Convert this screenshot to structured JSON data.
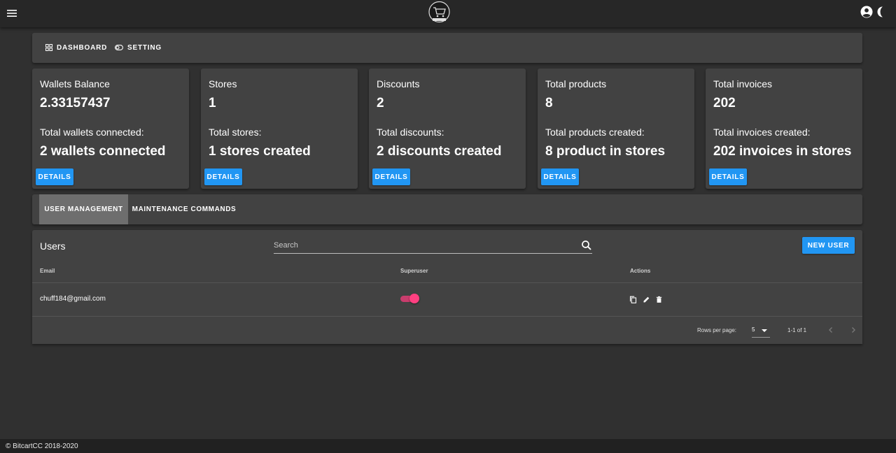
{
  "nav": {
    "dashboard_label": "DASHBOARD",
    "setting_label": "SETTING"
  },
  "stats": [
    {
      "title": "Wallets Balance",
      "value": "2.33157437",
      "subtitle": "Total wallets connected:",
      "summary": "2 wallets connected",
      "button": "DETAILS"
    },
    {
      "title": "Stores",
      "value": "1",
      "subtitle": "Total stores:",
      "summary": "1 stores created",
      "button": "DETAILS"
    },
    {
      "title": "Discounts",
      "value": "2",
      "subtitle": "Total discounts:",
      "summary": "2 discounts created",
      "button": "DETAILS"
    },
    {
      "title": "Total products",
      "value": "8",
      "subtitle": "Total products created:",
      "summary": "8 product in stores",
      "button": "DETAILS"
    },
    {
      "title": "Total invoices",
      "value": "202",
      "subtitle": "Total invoices created:",
      "summary": "202 invoices in stores",
      "button": "DETAILS"
    }
  ],
  "tabs": [
    {
      "label": "USER MANAGEMENT",
      "active": true
    },
    {
      "label": "MAINTENANCE COMMANDS",
      "active": false
    }
  ],
  "users": {
    "title": "Users",
    "search_placeholder": "Search",
    "search_value": "",
    "new_user_label": "NEW USER",
    "columns": [
      "Email",
      "Superuser",
      "Actions"
    ],
    "rows": [
      {
        "email": "chuff184@gmail.com",
        "superuser": true
      }
    ],
    "rows_per_page_label": "Rows per page:",
    "rows_per_page": "5",
    "range_text": "1-1 of 1"
  },
  "footer": {
    "copyright": "© BitcartCC 2018-2020"
  },
  "colors": {
    "primary": "#2196f3",
    "accent": "#ff4081",
    "surface": "#424242",
    "background": "#303030",
    "appbar": "#272727"
  },
  "icons": {
    "menu": "menu-icon",
    "logo": "bitcart-logo",
    "account": "account-circle-icon",
    "theme": "moon-icon",
    "dashboard": "dashboard-grid-icon",
    "setting": "toggle-icon",
    "search": "search-icon",
    "copy": "copy-icon",
    "edit": "pencil-icon",
    "delete": "trash-icon",
    "prev": "chevron-left-icon",
    "next": "chevron-right-icon"
  }
}
